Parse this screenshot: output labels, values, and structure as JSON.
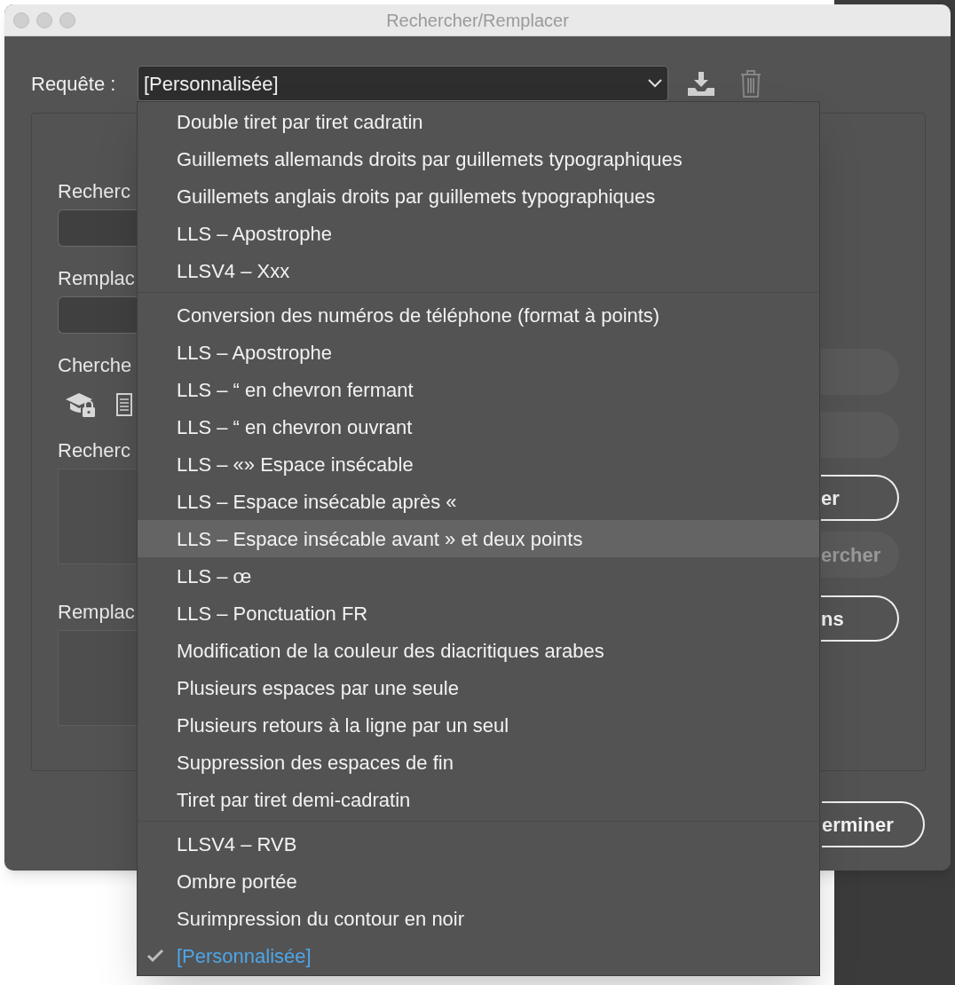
{
  "window": {
    "title": "Rechercher/Remplacer"
  },
  "query": {
    "label": "Requête :",
    "value": "[Personnalisée]"
  },
  "toolbar": [
    {
      "kind": "save",
      "disabled": false
    },
    {
      "kind": "delete",
      "disabled": true
    }
  ],
  "fields": [
    {
      "label": "Recherc",
      "kind": "line"
    },
    {
      "label": "Remplac",
      "kind": "line"
    },
    {
      "label": "Cherche",
      "kind": "icons"
    },
    {
      "label": "Recherc",
      "kind": "area"
    },
    {
      "label": "Remplac",
      "kind": "area"
    }
  ],
  "buttons": [
    {
      "disabled": true
    },
    {
      "disabled": true
    },
    {
      "label": "er",
      "disabled": false
    },
    {
      "label": "ercher",
      "disabled": true
    },
    {
      "label": "ns",
      "disabled": false
    }
  ],
  "done_button": {
    "label": "erminer"
  },
  "menu": {
    "sections": [
      {
        "items": [
          {
            "label": "Double tiret par tiret cadratin",
            "highlighted": false,
            "checked": false
          },
          {
            "label": "Guillemets allemands droits par guillemets typographiques",
            "highlighted": false,
            "checked": false
          },
          {
            "label": "Guillemets anglais droits par guillemets typographiques",
            "highlighted": false,
            "checked": false
          },
          {
            "label": "LLS – Apostrophe",
            "highlighted": false,
            "checked": false
          },
          {
            "label": "LLSV4 – Xxx",
            "highlighted": false,
            "checked": false
          }
        ]
      },
      {
        "items": [
          {
            "label": "Conversion des numéros de téléphone (format à points)",
            "highlighted": false,
            "checked": false
          },
          {
            "label": "LLS – Apostrophe",
            "highlighted": false,
            "checked": false
          },
          {
            "label": "LLS – “ en chevron fermant",
            "highlighted": false,
            "checked": false
          },
          {
            "label": "LLS – “ en chevron ouvrant",
            "highlighted": false,
            "checked": false
          },
          {
            "label": "LLS – «» Espace insécable",
            "highlighted": false,
            "checked": false
          },
          {
            "label": "LLS – Espace insécable après «",
            "highlighted": false,
            "checked": false
          },
          {
            "label": "LLS – Espace insécable avant » et deux points",
            "highlighted": true,
            "checked": false
          },
          {
            "label": "LLS – œ",
            "highlighted": false,
            "checked": false
          },
          {
            "label": "LLS – Ponctuation FR",
            "highlighted": false,
            "checked": false
          },
          {
            "label": "Modification de la couleur des diacritiques arabes",
            "highlighted": false,
            "checked": false
          },
          {
            "label": "Plusieurs espaces par une seule",
            "highlighted": false,
            "checked": false
          },
          {
            "label": "Plusieurs retours à la ligne par un seul",
            "highlighted": false,
            "checked": false
          },
          {
            "label": "Suppression des espaces de fin",
            "highlighted": false,
            "checked": false
          },
          {
            "label": "Tiret par tiret demi-cadratin",
            "highlighted": false,
            "checked": false
          }
        ]
      },
      {
        "items": [
          {
            "label": "LLSV4 – RVB",
            "highlighted": false,
            "checked": false
          },
          {
            "label": "Ombre portée",
            "highlighted": false,
            "checked": false
          },
          {
            "label": "Surimpression du contour en noir",
            "highlighted": false,
            "checked": false
          },
          {
            "label": "[Personnalisée]",
            "highlighted": false,
            "checked": true
          }
        ]
      }
    ]
  }
}
